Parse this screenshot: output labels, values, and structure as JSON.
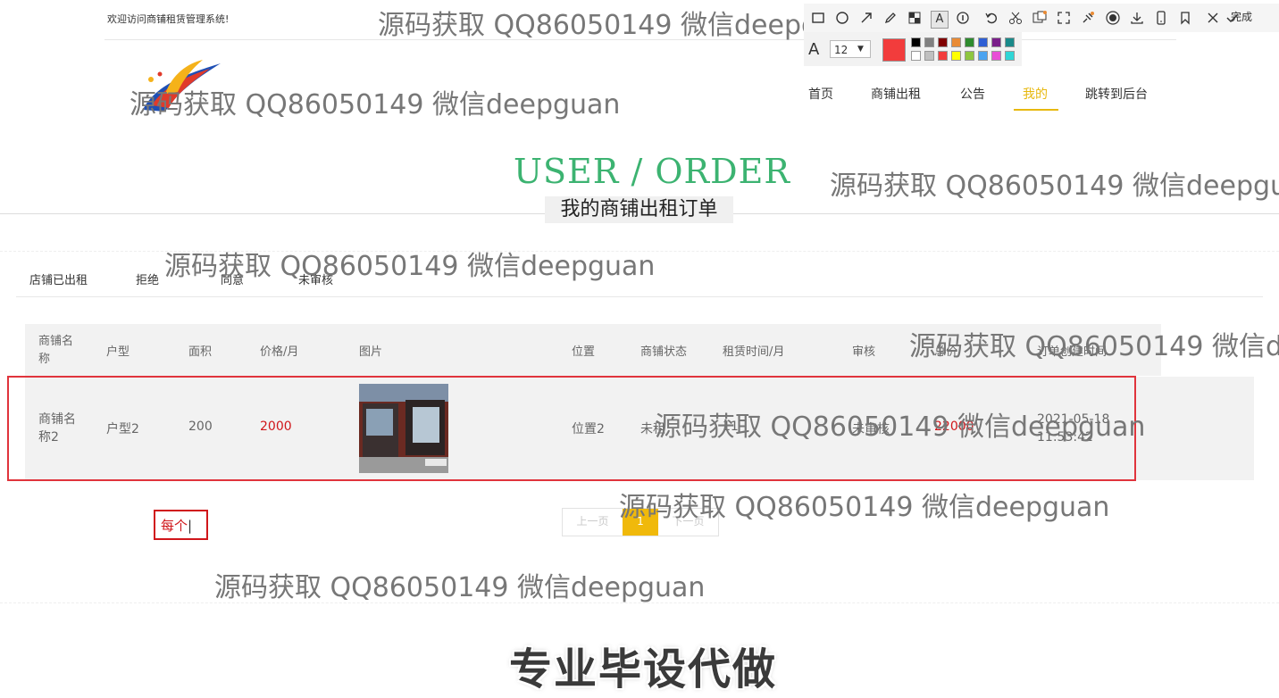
{
  "header": {
    "welcome": "欢迎访问商铺租赁管理系统!",
    "nav": [
      "首页",
      "商铺出租",
      "公告",
      "我的",
      "跳转到后台"
    ],
    "active_nav": "我的"
  },
  "title": {
    "en": "USER / ORDER",
    "cn": "我的商铺出租订单"
  },
  "tabs": [
    "店铺已出租",
    "拒绝",
    "同意",
    "未审核"
  ],
  "table": {
    "headers": [
      "商铺名称",
      "户型",
      "面积",
      "价格/月",
      "图片",
      "位置",
      "商铺状态",
      "租赁时间/月",
      "审核",
      "总价",
      "订单创建时间"
    ],
    "rows": [
      {
        "name": "商铺名称2",
        "type": "户型2",
        "area": "200",
        "price": "2000",
        "location": "位置2",
        "status": "未租",
        "lease_months": "11",
        "review": "未审核",
        "total": "22000",
        "created": "2021-05-18 11:53:42"
      }
    ]
  },
  "pager": {
    "prev": "上一页",
    "current": "1",
    "next": "下一页"
  },
  "annotation_text": "每个",
  "watermark": "源码获取 QQ86050149 微信deepguan",
  "banner": "专业毕设代做",
  "toolbar": {
    "done_label": "完成",
    "font_size": "12",
    "current_color": "#f23c3c",
    "icons": [
      "rect-icon",
      "ellipse-icon",
      "arrow-icon",
      "pencil-icon",
      "mosaic-icon",
      "text-icon",
      "number-icon",
      "undo-icon",
      "cut-icon",
      "ocr-icon",
      "fullscreen-icon",
      "pin-icon",
      "record-icon",
      "download-icon",
      "phone-icon",
      "bookmark-icon",
      "close-icon",
      "check-icon"
    ],
    "swatches": [
      "#000000",
      "#808080",
      "#800000",
      "#e98b35",
      "#2e8b2e",
      "#2f5fd4",
      "#7a1f8a",
      "#1a8a8a",
      "#ffffff",
      "#c0c0c0",
      "#f23c3c",
      "#ffff00",
      "#8ec63f",
      "#4aa3f0",
      "#e84ed6",
      "#2fd6d6"
    ]
  }
}
